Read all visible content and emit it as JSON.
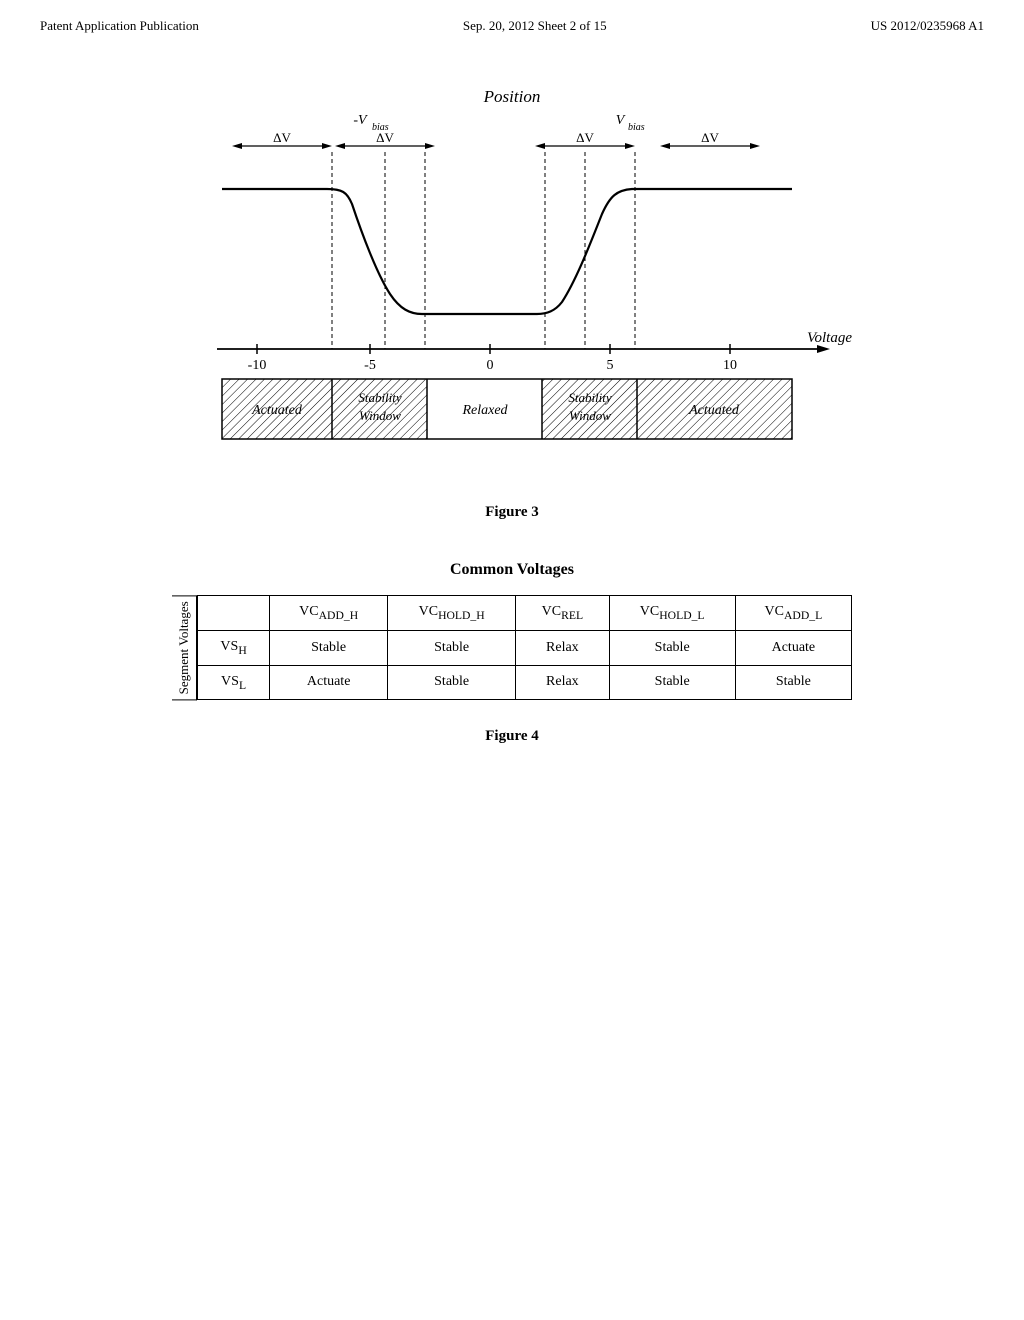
{
  "header": {
    "left": "Patent Application Publication",
    "center": "Sep. 20, 2012   Sheet 2 of 15",
    "right": "US 2012/0235968 A1"
  },
  "figure3": {
    "label": "Figure 3",
    "chart": {
      "position_label": "Position",
      "neg_vbias": "-V",
      "neg_vbias_sub": "bias",
      "pos_vbias": "V",
      "pos_vbias_sub": "bias",
      "delta_v_labels": [
        "ΔV",
        "ΔV",
        "ΔV",
        "ΔV"
      ],
      "voltage_label": "Voltage",
      "x_axis": [
        "-10",
        "-5",
        "0",
        "5",
        "10"
      ],
      "regions": [
        "Actuated",
        "Stability\nWindow",
        "Relaxed",
        "Stability\nWindow",
        "Actuated"
      ]
    }
  },
  "figure4": {
    "label": "Figure 4",
    "table_title": "Common Voltages",
    "vertical_label": "Segment Voltages",
    "columns": [
      "",
      "VCₐᴅᴅ_H|VCʜOLD_H",
      "VCᴿᴇL",
      "VCʜOLD_L",
      "VCₐᴅᴅ_L"
    ],
    "col_headers": [
      "VCADD_H",
      "VCHOLD_H",
      "VCREL",
      "VCHOLD_L",
      "VCADD_L"
    ],
    "rows": [
      {
        "row_label": "VSH",
        "row_label_main": "VS",
        "row_label_sub": "H",
        "cells": [
          "Stable",
          "Stable",
          "Relax",
          "Stable",
          "Actuate"
        ]
      },
      {
        "row_label": "VSL",
        "row_label_main": "VS",
        "row_label_sub": "L",
        "cells": [
          "Actuate",
          "Stable",
          "Relax",
          "Stable",
          "Stable"
        ]
      }
    ]
  }
}
